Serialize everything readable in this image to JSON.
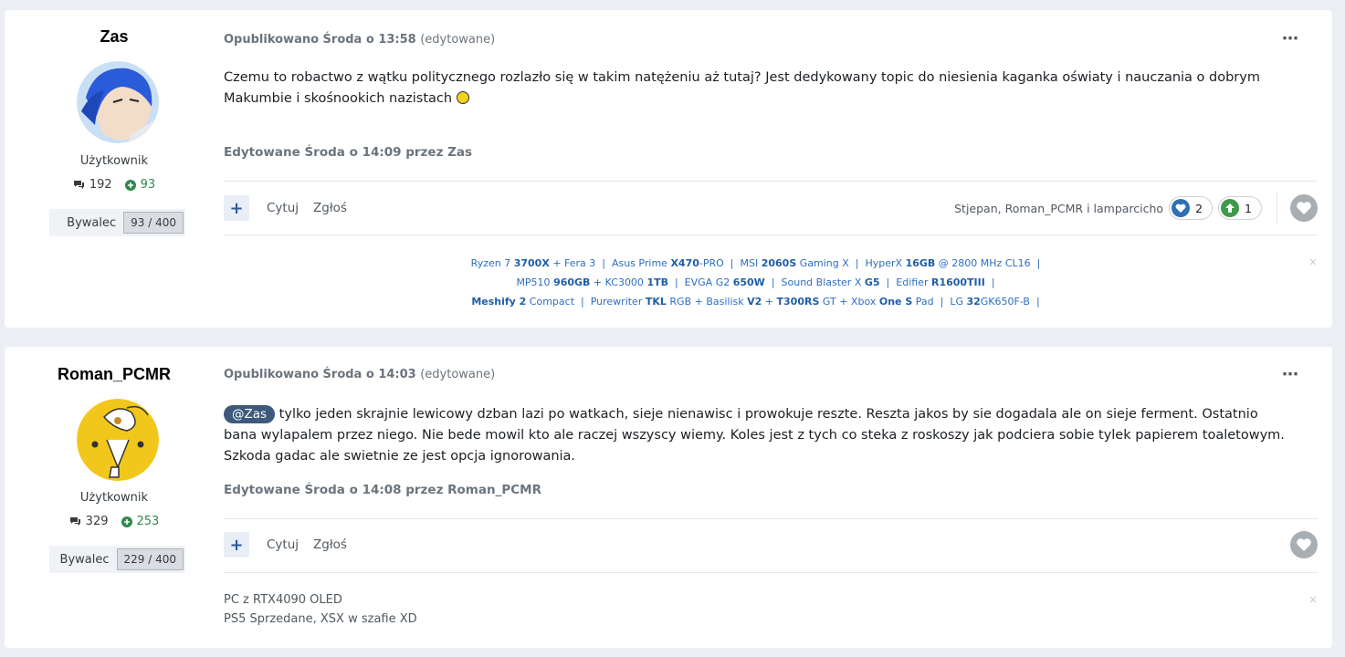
{
  "posts": [
    {
      "author": "Zas",
      "group": "Użytkownik",
      "posts_count": "192",
      "reputation": "93",
      "badge_label": "Bywalec",
      "badge_count": "93 / 400",
      "meta": "Opublikowano Środa o 13:58",
      "meta_edited": "(edytowane)",
      "content": "Czemu to robactwo z wątku politycznego rozlazło się w takim natężeniu aż tutaj? Jest dedykowany topic do niesienia kaganka oświaty i nauczania o dobrym Makumbie i skośnookich nazistach",
      "edit_note": "Edytowane Środa o 14:09 przez Zas",
      "actions": {
        "quote": "Cytuj",
        "report": "Zgłoś"
      },
      "reacted_by": "Stjepan, Roman_PCMR i lamparcicho",
      "reactions": [
        {
          "icon": "heart-reaction-icon",
          "count": "2",
          "color": "#2f6fb6"
        },
        {
          "icon": "upvote-reaction-icon",
          "count": "1",
          "color": "#3f9a4a"
        }
      ],
      "signature_lines": [
        [
          [
            "Ryzen 7 ",
            false
          ],
          [
            "3700X",
            true
          ],
          [
            " + Fera 3  |  Asus Prime ",
            false
          ],
          [
            "X470",
            true
          ],
          [
            "-PRO  |  MSI ",
            false
          ],
          [
            "2060S",
            true
          ],
          [
            " Gaming X  |  HyperX ",
            false
          ],
          [
            "16GB",
            true
          ],
          [
            " @ 2800 MHz CL16  |",
            false
          ]
        ],
        [
          [
            "MP510 ",
            false
          ],
          [
            "960GB",
            true
          ],
          [
            " + KC3000 ",
            false
          ],
          [
            "1TB",
            true
          ],
          [
            "  |  EVGA G2 ",
            false
          ],
          [
            "650W",
            true
          ],
          [
            "  |  Sound Blaster X ",
            false
          ],
          [
            "G5",
            true
          ],
          [
            "  |  Edifier ",
            false
          ],
          [
            "R1600TIII",
            true
          ],
          [
            "  |",
            false
          ]
        ],
        [
          [
            "Meshify 2",
            true
          ],
          [
            " Compact  |  Purewriter ",
            false
          ],
          [
            "TKL",
            true
          ],
          [
            " RGB + Basilisk ",
            false
          ],
          [
            "V2",
            true
          ],
          [
            " + ",
            false
          ],
          [
            "T300RS",
            true
          ],
          [
            " GT + Xbox ",
            false
          ],
          [
            "One S",
            true
          ],
          [
            " Pad  |  LG ",
            false
          ],
          [
            "32",
            true
          ],
          [
            "GK650F-B  |",
            false
          ]
        ]
      ]
    },
    {
      "author": "Roman_PCMR",
      "group": "Użytkownik",
      "posts_count": "329",
      "reputation": "253",
      "badge_label": "Bywalec",
      "badge_count": "229 / 400",
      "meta": "Opublikowano Środa o 14:03",
      "meta_edited": "(edytowane)",
      "mention": "@Zas",
      "content": " tylko jeden skrajnie lewicowy dzban lazi po watkach, sieje nienawisc i prowokuje reszte. Reszta jakos by sie dogadala ale on sieje ferment. Ostatnio bana wylapalem przez niego. Nie bede mowil kto ale raczej wszyscy wiemy. Koles jest z tych co steka z roskoszy jak podciera sobie tylek papierem toaletowym. Szkoda gadac ale swietnie ze jest opcja ignorowania.",
      "edit_note": "Edytowane Środa o 14:08 przez Roman_PCMR",
      "actions": {
        "quote": "Cytuj",
        "report": "Zgłoś"
      },
      "signature_plain": [
        "PC z RTX4090 OLED",
        "PS5 Sprzedane, XSX w szafie XD"
      ]
    }
  ],
  "icons": {
    "more": "⋯",
    "plus": "+",
    "close": "×",
    "posts": "comment-icon",
    "reputation": "plus-circle-icon"
  },
  "colors": {
    "page_bg": "#ebeef2",
    "link_blue": "#2d6ec2",
    "rep_green": "#2f8a4a",
    "mention_bg": "#3d5a7c"
  }
}
